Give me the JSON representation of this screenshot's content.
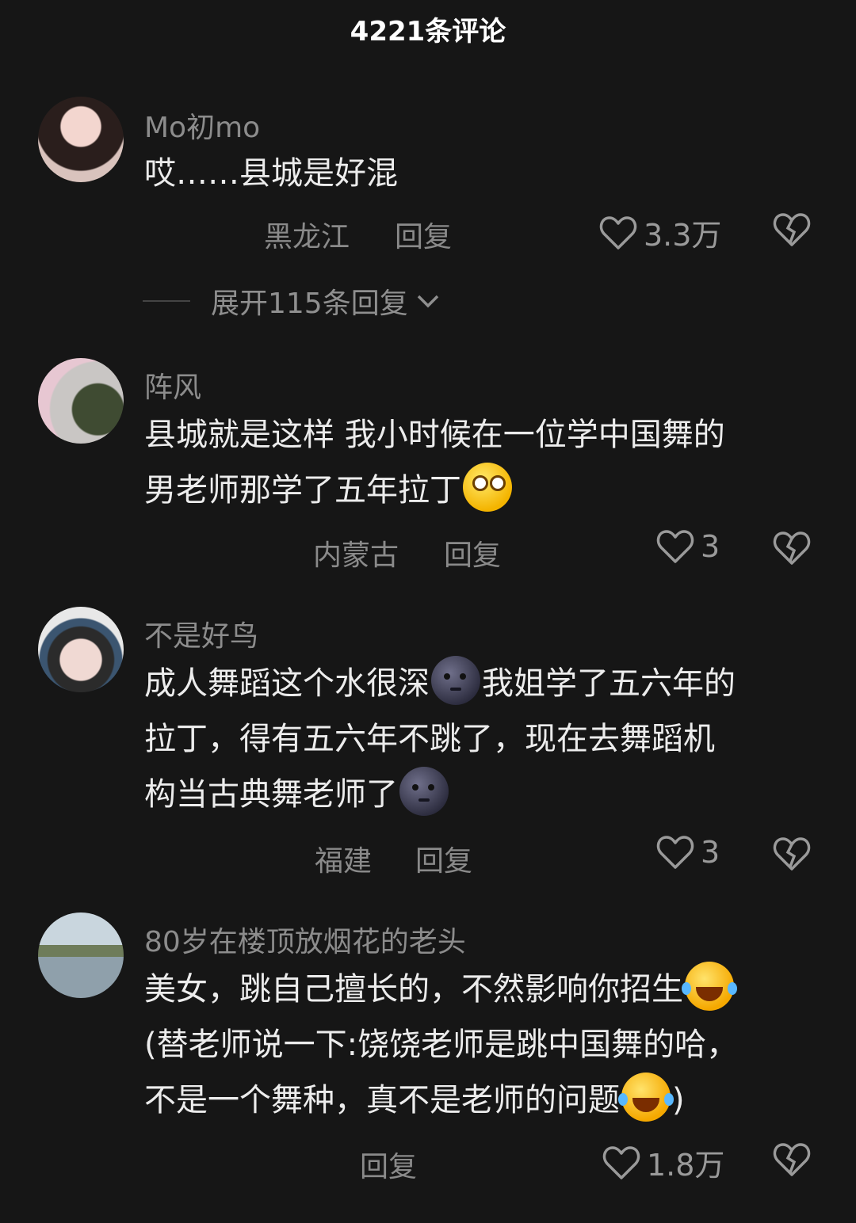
{
  "header": {
    "title": "4221条评论"
  },
  "comments": [
    {
      "username": "Mo初mo",
      "lines": [
        "哎……县城是好混"
      ],
      "location": "黑龙江",
      "reply_label": "回复",
      "likes": "3.3万",
      "expand_label": "展开115条回复"
    },
    {
      "username": "阵风",
      "lines": [
        "县城就是这样 我小时候在一位学中国舞的",
        "男老师那学了五年拉丁"
      ],
      "emoji": "smile-emoji",
      "location": "内蒙古",
      "reply_label": "回复",
      "likes": "3"
    },
    {
      "username": "不是好鸟",
      "lines": [
        "成人舞蹈这个水很深",
        "我姐学了五六年的",
        "拉丁，得有五六年不跳了，现在去舞蹈机",
        "构当古典舞老师了"
      ],
      "emoji": "new-moon-face-emoji",
      "location": "福建",
      "reply_label": "回复",
      "likes": "3"
    },
    {
      "username": "80岁在楼顶放烟花的老头",
      "lines": [
        "美女，跳自己擅长的，不然影响你招生",
        "(替老师说一下:饶饶老师是跳中国舞的哈，",
        "不是一个舞种，真不是老师的问题",
        ")"
      ],
      "emoji": "laughing-tears-emoji",
      "reply_label": "回复",
      "likes": "1.8万"
    }
  ],
  "colors": {
    "background": "#161616",
    "text": "#ececec",
    "muted": "#8a8a8a"
  }
}
